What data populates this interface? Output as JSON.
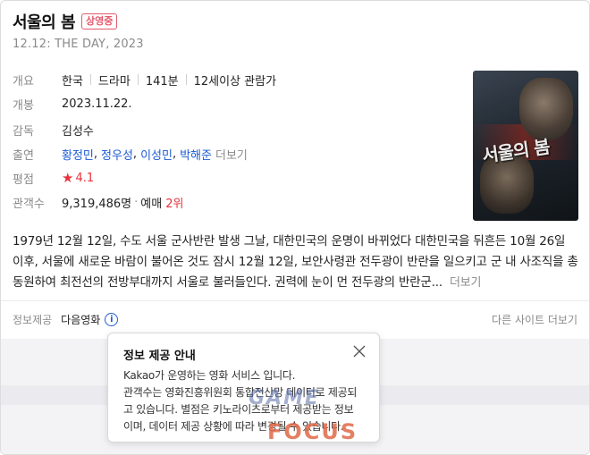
{
  "movie": {
    "title": "서울의 봄",
    "badge": "상영중",
    "subtitle": "12.12: THE DAY, 2023"
  },
  "info": {
    "overview": {
      "label": "개요",
      "values": [
        "한국",
        "드라마",
        "141분",
        "12세이상 관람가"
      ]
    },
    "release": {
      "label": "개봉",
      "value": "2023.11.22."
    },
    "director": {
      "label": "감독",
      "value": "김성수"
    },
    "cast": {
      "label": "출연",
      "names": [
        "황정민",
        "정우성",
        "이성민",
        "박해준"
      ],
      "more": "더보기"
    },
    "rating": {
      "label": "평점",
      "value": "4.1",
      "star": "★"
    },
    "audience": {
      "label": "관객수",
      "value": "9,319,486명",
      "reservation_label": "예매",
      "reservation_rank": "2위"
    }
  },
  "poster": {
    "title": "서울의 봄"
  },
  "synopsis": {
    "text": "1979년 12월 12일, 수도 서울 군사반란 발생 그날, 대한민국의 운명이 바뀌었다 대한민국을 뒤흔든 10월 26일 이후, 서울에 새로운 바람이 불어온 것도 잠시 12월 12일, 보안사령관 전두광이 반란을 일으키고 군 내 사조직을 총동원하여 최전선의 전방부대까지 서울로 불러들인다. 권력에 눈이 먼 전두광의 반란군...",
    "more": "더보기"
  },
  "footer": {
    "provider_label": "정보제공",
    "provider": "다음영화",
    "info_icon": "i",
    "other_sites": "다른 사이트 더보기"
  },
  "popup": {
    "title": "정보 제공 안내",
    "lines": [
      "Kakao가 운영하는 영화 서비스 입니다.",
      "관객수는 영화진흥위원회 통합전산망 데이터로 제공되",
      "고 있습니다. 별점은 키노라이츠로부터 제공받는 정보",
      "이며, 데이터 제공 상황에 따라 변경될 수 있습니다."
    ]
  },
  "watermark": {
    "line1": "GAME",
    "line2": "FOCUS"
  },
  "colors": {
    "accent_red": "#e8323c",
    "link_blue": "#1a5bd6",
    "label_grey": "#8a8a8a"
  }
}
